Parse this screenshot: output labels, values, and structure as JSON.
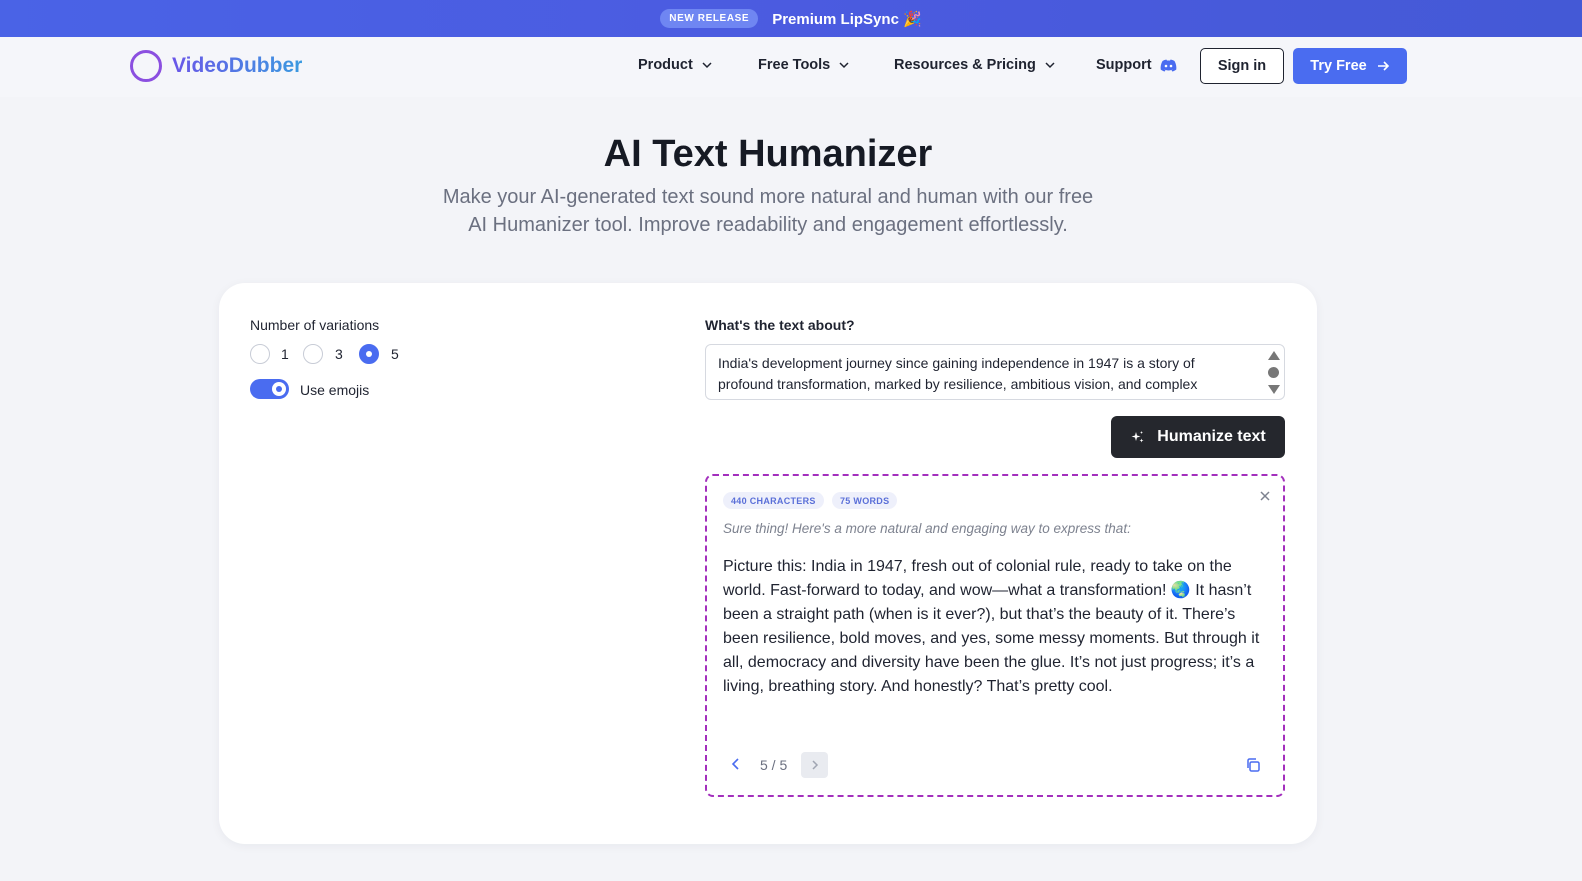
{
  "banner": {
    "badge": "NEW RELEASE",
    "text": "Premium LipSync 🎉"
  },
  "nav": {
    "logo_text": "VideoDubber",
    "items": [
      {
        "label": "Product",
        "icon": "chevron-down-icon"
      },
      {
        "label": "Free Tools",
        "icon": "chevron-down-icon"
      },
      {
        "label": "Resources & Pricing",
        "icon": "chevron-down-icon"
      },
      {
        "label": "Support",
        "icon": "discord-icon"
      }
    ],
    "sign_in": "Sign in",
    "try_free": "Try Free"
  },
  "hero": {
    "title": "AI Text Humanizer",
    "subtitle": "Make your AI-generated text sound more natural and human with our free AI Humanizer tool. Improve readability and engagement effortlessly."
  },
  "settings": {
    "variations_label": "Number of variations",
    "options": [
      "1",
      "3",
      "5"
    ],
    "selected": "5",
    "emoji_label": "Use emojis",
    "emoji_enabled": true
  },
  "input": {
    "label": "What's the text about?",
    "value": "India's development journey since gaining independence in 1947 is a story of profound transformation, marked by resilience, ambitious vision, and complex"
  },
  "action": {
    "humanize_label": "Humanize text"
  },
  "result": {
    "characters": "440 CHARACTERS",
    "words": "75 WORDS",
    "intro": "Sure thing! Here's a more natural and engaging way to express that:",
    "text": "Picture this: India in 1947, fresh out of colonial rule, ready to take on the world. Fast-forward to today, and wow—what a transformation! 🌏 It hasn’t been a straight path (when is it ever?), but that’s the beauty of it. There’s been resilience, bold moves, and yes, some messy moments. But through it all, democracy and diversity have been the glue. It’s not just progress; it’s a living, breathing story. And honestly? That’s pretty cool.",
    "pager": "5 / 5"
  },
  "colors": {
    "accent": "#4a6cf0",
    "banner": "#4b5be0",
    "dashed_border": "#a32fbd",
    "dark_button": "#25272d"
  }
}
